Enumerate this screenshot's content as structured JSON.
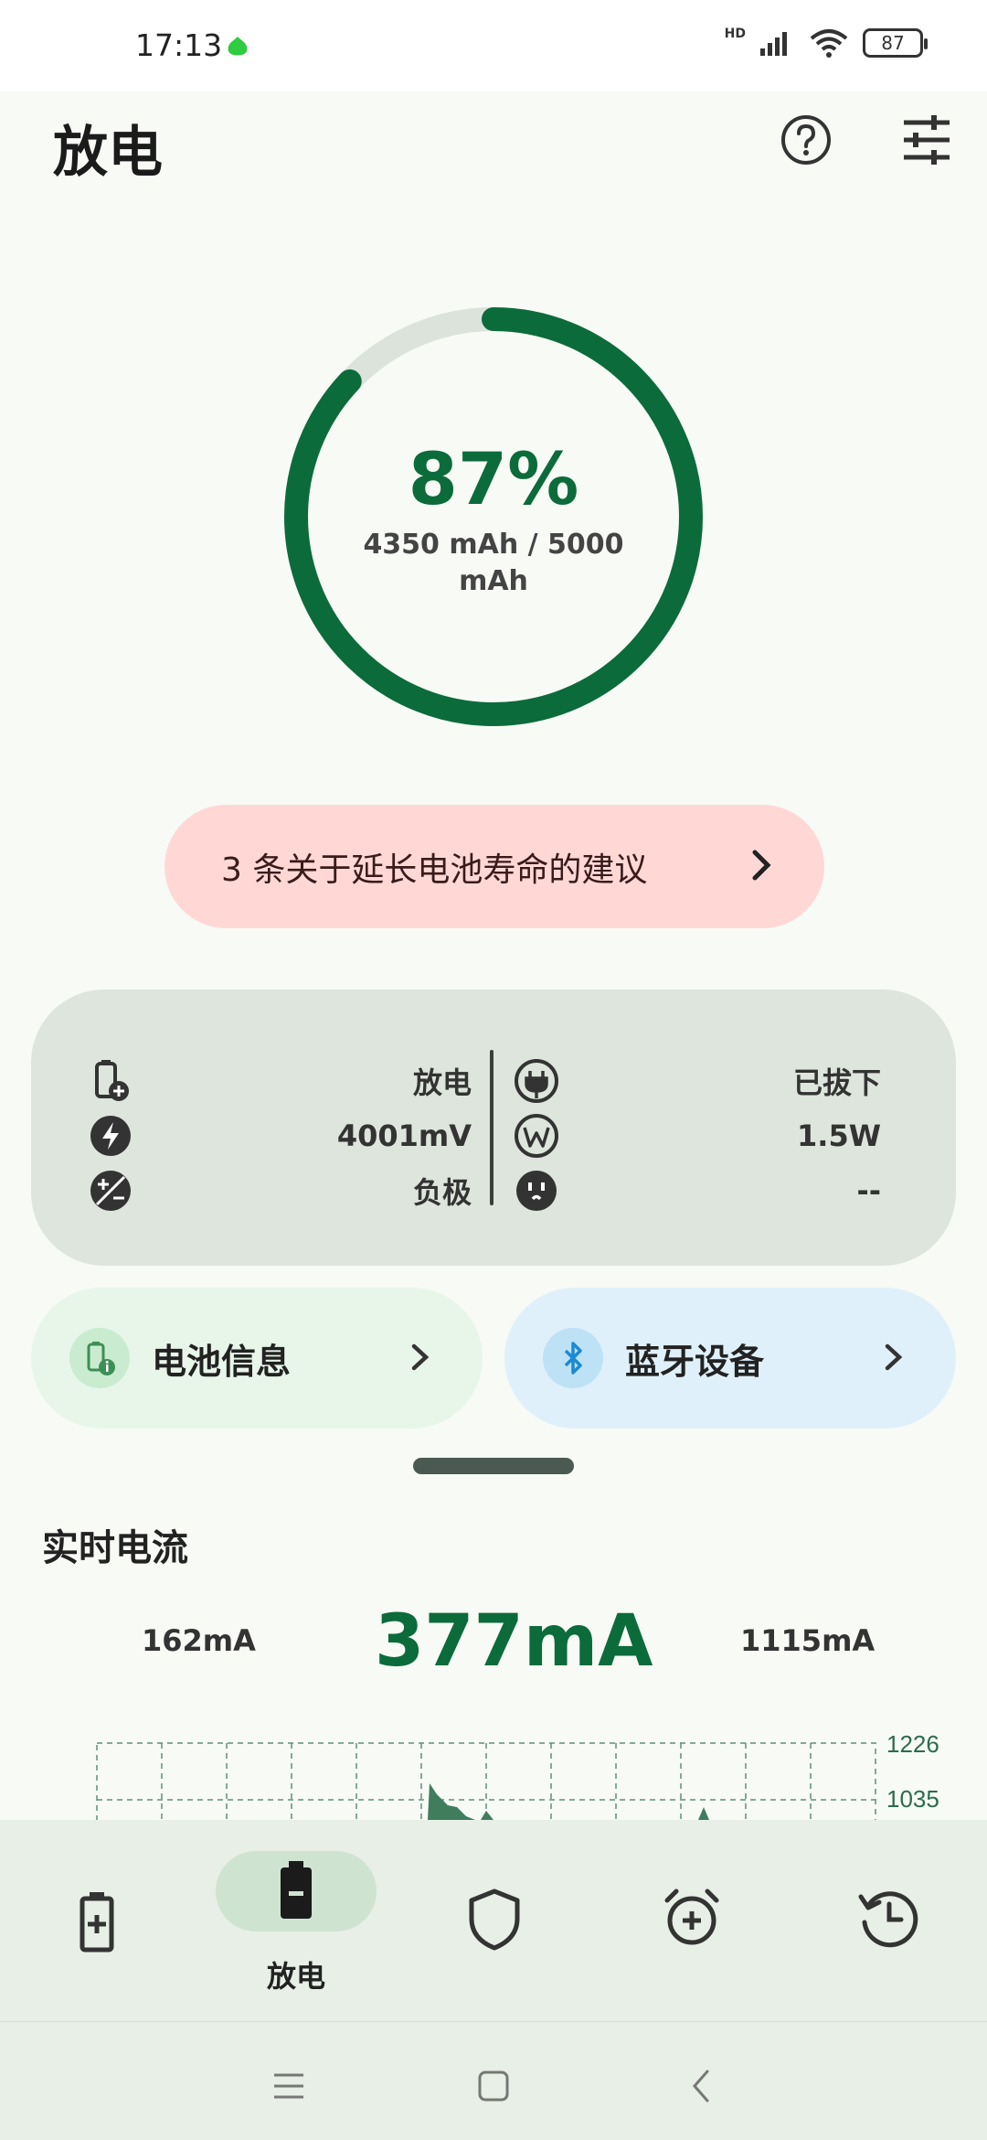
{
  "status": {
    "time": "17:13",
    "network": "HD",
    "battery_level": "87"
  },
  "header": {
    "title": "放电"
  },
  "ring": {
    "percent_text": "87%",
    "capacity_text": "4350 mAh / 5000 mAh",
    "fill_fraction": 0.87,
    "color_fill": "#0c6b3a",
    "color_track": "#dbe3da"
  },
  "tip": {
    "label": "3 条关于延长电池寿命的建议"
  },
  "info_card": {
    "left": [
      {
        "icon": "battery-plus-icon",
        "value": "放电"
      },
      {
        "icon": "bolt-icon",
        "value": "4001mV"
      },
      {
        "icon": "plus-minus-icon",
        "value": "负极"
      }
    ],
    "right": [
      {
        "icon": "plug-icon",
        "value": "已拔下"
      },
      {
        "icon": "watt-icon",
        "value": "1.5W"
      },
      {
        "icon": "outlet-icon",
        "value": "--"
      }
    ]
  },
  "chips": {
    "battery_info": {
      "label": "电池信息",
      "icon": "battery-info-icon",
      "bg": "#e8f6ea"
    },
    "bluetooth": {
      "label": "蓝牙设备",
      "icon": "bluetooth-icon",
      "bg": "#dff0fa"
    }
  },
  "realtime": {
    "title": "实时电流",
    "min": "162mA",
    "current": "377mA",
    "max": "1115mA",
    "y_ticks": [
      "1226",
      "1035"
    ]
  },
  "bottom_nav": {
    "items": [
      {
        "icon": "battery-charge-icon",
        "label": ""
      },
      {
        "icon": "battery-discharge-icon",
        "label": "放电"
      },
      {
        "icon": "shield-icon",
        "label": ""
      },
      {
        "icon": "alarm-add-icon",
        "label": ""
      },
      {
        "icon": "history-icon",
        "label": ""
      }
    ]
  }
}
